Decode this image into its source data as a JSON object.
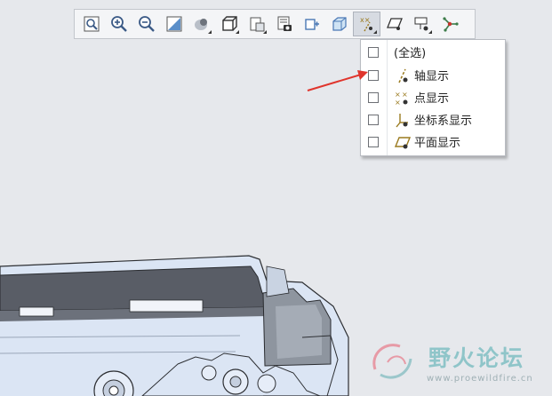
{
  "colors": {
    "background": "#e6e8ec",
    "model_dark": "#585c64",
    "model_light": "#dbe5f4",
    "arrow": "#e0352d",
    "axis_icon": "#9a7a1f"
  },
  "toolbar": {
    "buttons": [
      {
        "name": "refit-icon",
        "active": false
      },
      {
        "name": "zoom-in-icon",
        "active": false
      },
      {
        "name": "zoom-out-icon",
        "active": false
      },
      {
        "name": "repaint-icon",
        "active": false
      },
      {
        "name": "perspective-icon",
        "active": false
      },
      {
        "name": "named-view-icon",
        "active": false
      },
      {
        "name": "saved-orientation-icon",
        "active": false
      },
      {
        "name": "view-manager-icon",
        "active": false
      },
      {
        "name": "display-style-icon",
        "active": false
      },
      {
        "name": "section-view-icon",
        "active": false
      },
      {
        "name": "datum-display-icon",
        "active": true
      },
      {
        "name": "plane-display-icon",
        "active": false
      },
      {
        "name": "annotation-display-icon",
        "active": false
      },
      {
        "name": "spin-center-icon",
        "active": false
      }
    ]
  },
  "menu": {
    "items": [
      {
        "label": "(全选)",
        "icon": "",
        "checked": false
      },
      {
        "label": "轴显示",
        "icon": "axis-icon",
        "checked": false
      },
      {
        "label": "点显示",
        "icon": "point-icon",
        "checked": false
      },
      {
        "label": "坐标系显示",
        "icon": "csys-icon",
        "checked": false
      },
      {
        "label": "平面显示",
        "icon": "plane-icon",
        "checked": false
      }
    ]
  },
  "watermark": {
    "title": "野火论坛",
    "url": "www.proewildfire.cn"
  }
}
